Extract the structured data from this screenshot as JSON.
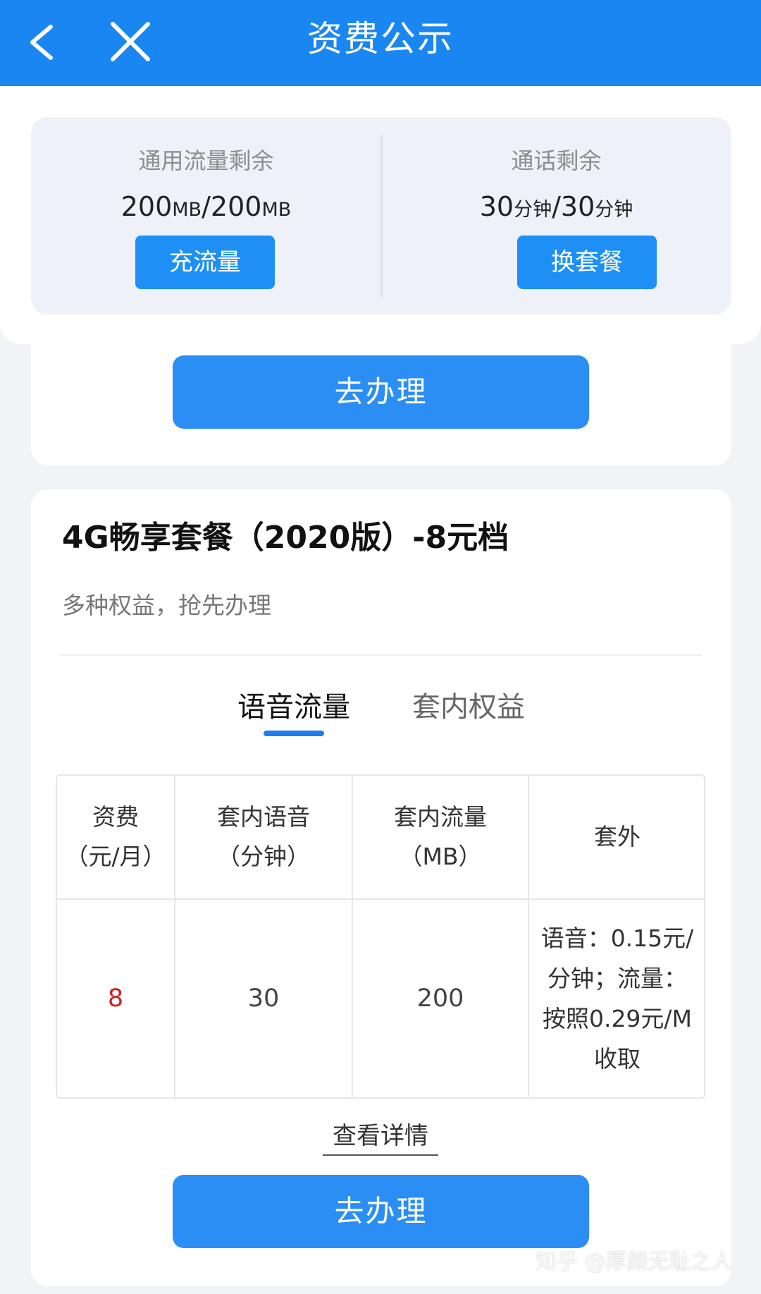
{
  "header": {
    "title": "资费公示"
  },
  "usage": {
    "data": {
      "label": "通用流量剩余",
      "remaining": "200",
      "remaining_unit": "MB",
      "separator": "/",
      "total": "200",
      "total_unit": "MB",
      "button": "充流量"
    },
    "voice": {
      "label": "通话剩余",
      "remaining": "30",
      "remaining_unit": "分钟",
      "separator": "/",
      "total": "30",
      "total_unit": "分钟",
      "button": "换套餐"
    }
  },
  "actions": {
    "apply_label": "去办理"
  },
  "plan": {
    "title": "4G畅享套餐（2020版）-8元档",
    "subtitle": "多种权益，抢先办理",
    "tabs": [
      {
        "label": "语音流量",
        "active": true
      },
      {
        "label": "套内权益",
        "active": false
      }
    ],
    "table": {
      "headers": [
        [
          "资费",
          "（元/月）"
        ],
        [
          "套内语音",
          "（分钟）"
        ],
        [
          "套内流量",
          "（MB）"
        ],
        [
          "套外"
        ]
      ],
      "row": {
        "price": "8",
        "voice": "30",
        "data": "200",
        "extra": [
          "语音：0.15元/",
          "分钟；流量：",
          "按照0.29元/M",
          "收取"
        ]
      }
    },
    "detail_link": "查看详情",
    "apply_label": "去办理"
  },
  "watermark": "知乎 @厚颜无耻之人",
  "colors": {
    "brand_blue": "#1a86f2",
    "button_blue": "#2a8ef5",
    "price_red": "#d32020",
    "background": "#f2f3f7"
  }
}
